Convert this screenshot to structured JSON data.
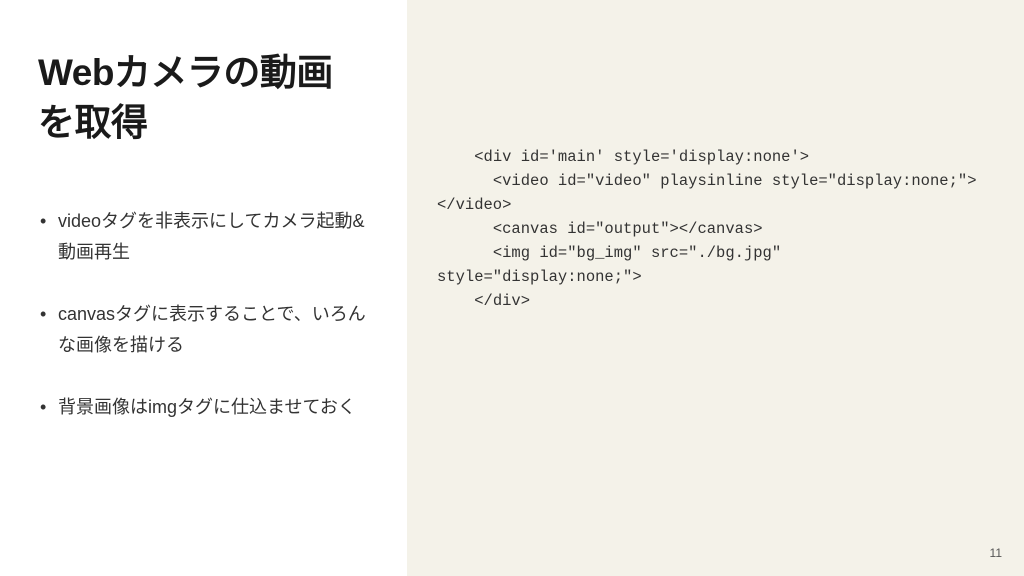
{
  "left": {
    "title": "Webカメラの動画を取得",
    "bullets": [
      "videoタグを非表示にしてカメラ起動&動画再生",
      "canvasタグに表示することで、いろんな画像を描ける",
      "背景画像はimgタグに仕込ませておく"
    ]
  },
  "right": {
    "code": "    <div id='main' style='display:none'>\n      <video id=\"video\" playsinline style=\"display:none;\"></video>\n      <canvas id=\"output\"></canvas>\n      <img id=\"bg_img\" src=\"./bg.jpg\" style=\"display:none;\">\n    </div>"
  },
  "page_number": "11"
}
